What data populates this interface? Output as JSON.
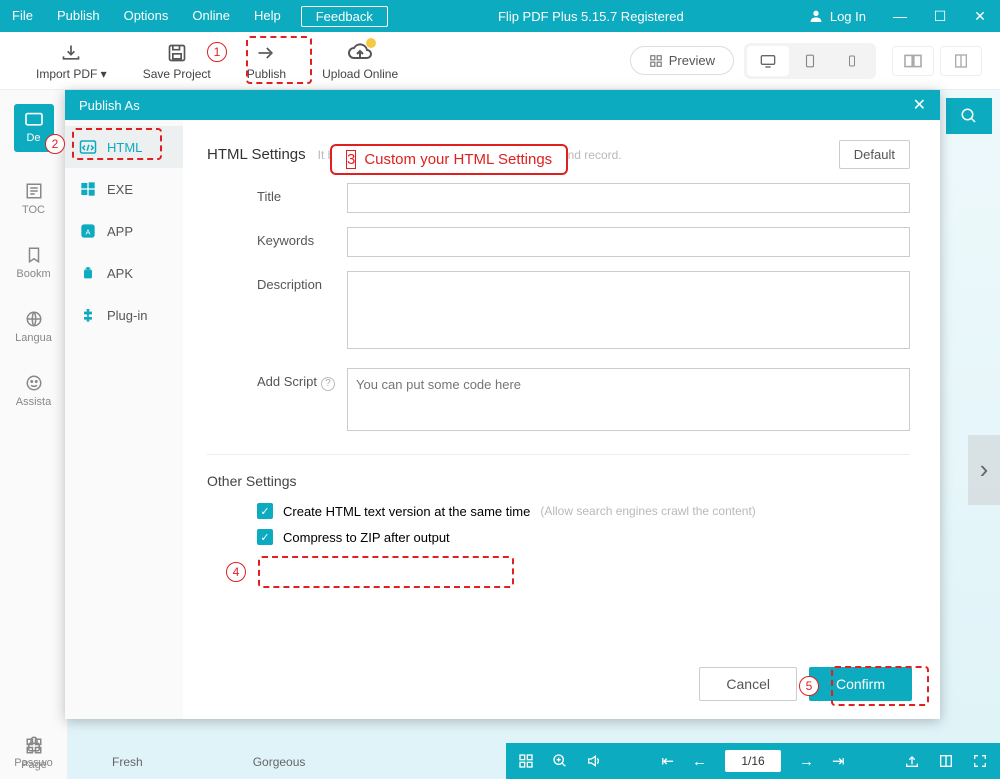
{
  "titlebar": {
    "menus": [
      "File",
      "Publish",
      "Options",
      "Online",
      "Help"
    ],
    "feedback": "Feedback",
    "app_title": "Flip PDF Plus 5.15.7 Registered",
    "login": "Log In"
  },
  "toolbar": {
    "import": "Import PDF ▾",
    "save": "Save Project",
    "publish": "Publish",
    "upload": "Upload Online",
    "preview": "Preview"
  },
  "leftnav": {
    "design": "De",
    "toc": "TOC",
    "bookmark": "Bookm",
    "language": "Langua",
    "assistant": "Assista",
    "password": "Passwo",
    "page": "Page"
  },
  "thumbs": {
    "a": "Fresh",
    "b": "Gorgeous"
  },
  "viewer": {
    "page": "1/16"
  },
  "modal": {
    "title": "Publish As",
    "tabs": {
      "html": "HTML",
      "exe": "EXE",
      "app": "APP",
      "apk": "APK",
      "plugin": "Plug-in"
    },
    "settings_title": "HTML Settings",
    "settings_hint": "It benefits the serach engine to identify, index and record.",
    "default": "Default",
    "fields": {
      "title": "Title",
      "keywords": "Keywords",
      "description": "Description",
      "addscript": "Add Script",
      "script_ph": "You can put some code here"
    },
    "other_title": "Other Settings",
    "chk1": "Create HTML text version at the same time",
    "chk1_hint": "(Allow search engines crawl the content)",
    "chk2": "Compress to ZIP after output",
    "cancel": "Cancel",
    "confirm": "Confirm"
  },
  "annotations": {
    "callout3": "Custom your HTML Settings"
  }
}
